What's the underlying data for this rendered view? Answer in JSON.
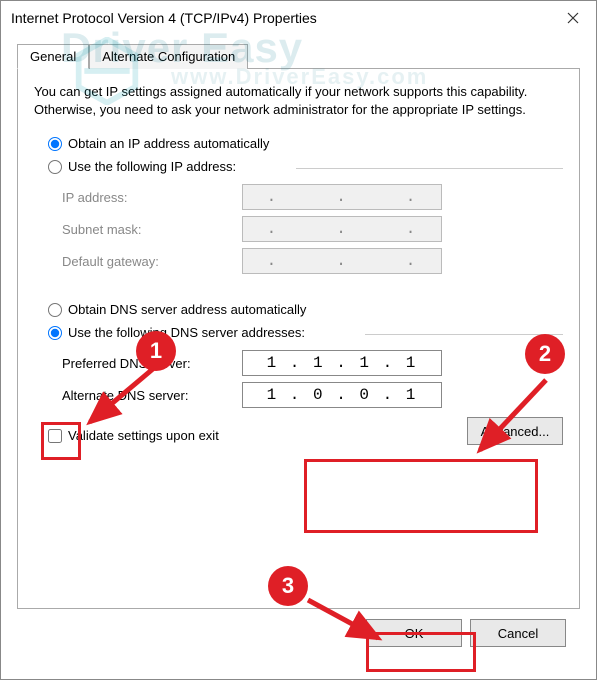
{
  "window": {
    "title": "Internet Protocol Version 4 (TCP/IPv4) Properties"
  },
  "tabs": {
    "general": "General",
    "alternate": "Alternate Configuration"
  },
  "info": "You can get IP settings assigned automatically if your network supports this capability. Otherwise, you need to ask your network administrator for the appropriate IP settings.",
  "ip_section": {
    "auto_label": "Obtain an IP address automatically",
    "manual_label": "Use the following IP address:",
    "ip_label": "IP address:",
    "subnet_label": "Subnet mask:",
    "gateway_label": "Default gateway:",
    "ip_value": ".     .     .",
    "subnet_value": ".     .     .",
    "gateway_value": ".     .     ."
  },
  "dns_section": {
    "auto_label": "Obtain DNS server address automatically",
    "manual_label": "Use the following DNS server addresses:",
    "preferred_label": "Preferred DNS server:",
    "alternate_label": "Alternate DNS server:",
    "preferred_value": "1 . 1 . 1 . 1",
    "alternate_value": "1 . 0 . 0 . 1"
  },
  "validate_label": "Validate settings upon exit",
  "buttons": {
    "advanced": "Advanced...",
    "ok": "OK",
    "cancel": "Cancel"
  },
  "annotations": {
    "circle1": "1",
    "circle2": "2",
    "circle3": "3"
  },
  "watermark": {
    "main": "Driver Easy",
    "sub": "www.DriverEasy.com"
  }
}
